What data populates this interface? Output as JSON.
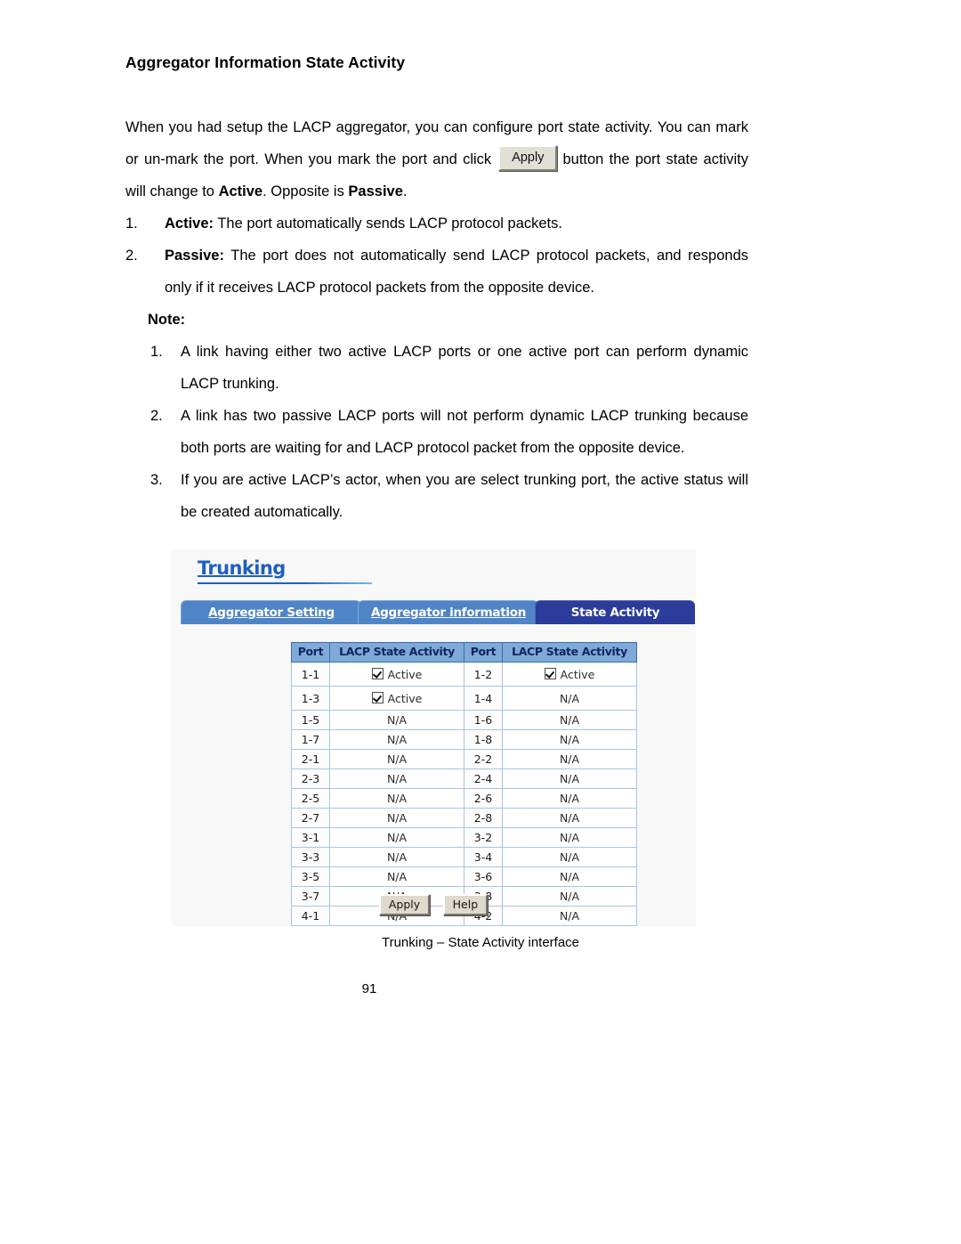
{
  "document": {
    "title": "Aggregator Information State Activity",
    "paragraph1_a": "When you had setup the LACP aggregator, you can configure port state activity. You can mark or un-mark the port. When you mark the port and click",
    "apply_button_label": "Apply",
    "paragraph1_b": "button the port state activity will change to",
    "paragraph1_bold1": "Active",
    "paragraph1_c": ". Opposite is",
    "paragraph1_bold2": "Passive",
    "paragraph1_d": ".",
    "main_list": [
      {
        "number": "1.",
        "term": "Active:",
        "text": "The port automatically sends LACP protocol packets."
      },
      {
        "number": "2.",
        "term": "Passive:",
        "text": "The port does not automatically send LACP protocol packets, and responds only if it receives LACP protocol packets from the opposite device."
      }
    ],
    "note_heading": "Note:",
    "note_list": [
      {
        "number": "1.",
        "text": "A link having either two active LACP ports or one active port can perform dynamic LACP trunking."
      },
      {
        "number": "2.",
        "text": "A link has two passive LACP ports will not perform dynamic LACP trunking because both ports are waiting for and LACP protocol packet from the opposite device."
      },
      {
        "number": "3.",
        "text": "If you are active LACP’s actor, when you are select trunking port, the active status will be created automatically."
      }
    ],
    "figure_caption": "Trunking – State Activity interface",
    "page_number": "91"
  },
  "screenshot": {
    "app_title": "Trunking",
    "tabs": [
      {
        "label": "Aggregator Setting",
        "active": false
      },
      {
        "label": "Aggregator information",
        "active": false
      },
      {
        "label": "State Activity",
        "active": true
      }
    ],
    "table": {
      "headers": [
        "Port",
        "LACP State Activity",
        "Port",
        "LACP State Activity"
      ],
      "active_label": "Active",
      "na_label": "N/A",
      "rows": [
        {
          "port_left": "1-1",
          "state_left": "Active",
          "checked_left": true,
          "port_right": "1-2",
          "state_right": "Active",
          "checked_right": true
        },
        {
          "port_left": "1-3",
          "state_left": "Active",
          "checked_left": true,
          "port_right": "1-4",
          "state_right": "N/A",
          "checked_right": false
        },
        {
          "port_left": "1-5",
          "state_left": "N/A",
          "checked_left": false,
          "port_right": "1-6",
          "state_right": "N/A",
          "checked_right": false
        },
        {
          "port_left": "1-7",
          "state_left": "N/A",
          "checked_left": false,
          "port_right": "1-8",
          "state_right": "N/A",
          "checked_right": false
        },
        {
          "port_left": "2-1",
          "state_left": "N/A",
          "checked_left": false,
          "port_right": "2-2",
          "state_right": "N/A",
          "checked_right": false
        },
        {
          "port_left": "2-3",
          "state_left": "N/A",
          "checked_left": false,
          "port_right": "2-4",
          "state_right": "N/A",
          "checked_right": false
        },
        {
          "port_left": "2-5",
          "state_left": "N/A",
          "checked_left": false,
          "port_right": "2-6",
          "state_right": "N/A",
          "checked_right": false
        },
        {
          "port_left": "2-7",
          "state_left": "N/A",
          "checked_left": false,
          "port_right": "2-8",
          "state_right": "N/A",
          "checked_right": false
        },
        {
          "port_left": "3-1",
          "state_left": "N/A",
          "checked_left": false,
          "port_right": "3-2",
          "state_right": "N/A",
          "checked_right": false
        },
        {
          "port_left": "3-3",
          "state_left": "N/A",
          "checked_left": false,
          "port_right": "3-4",
          "state_right": "N/A",
          "checked_right": false
        },
        {
          "port_left": "3-5",
          "state_left": "N/A",
          "checked_left": false,
          "port_right": "3-6",
          "state_right": "N/A",
          "checked_right": false
        },
        {
          "port_left": "3-7",
          "state_left": "N/A",
          "checked_left": false,
          "port_right": "3-8",
          "state_right": "N/A",
          "checked_right": false
        },
        {
          "port_left": "4-1",
          "state_left": "N/A",
          "checked_left": false,
          "port_right": "4-2",
          "state_right": "N/A",
          "checked_right": false
        }
      ]
    },
    "buttons": [
      {
        "label": "Apply"
      },
      {
        "label": "Help"
      }
    ],
    "colors": {
      "title": "#1f5fbf",
      "tab_inactive": "#4f85c6",
      "tab_active": "#2b3c9b",
      "table_header_bg": "#7fa9d8",
      "table_header_text": "#10265c",
      "table_border": "#3a6ea8",
      "panel_bg": "#f8f8f8",
      "button_face": "#dedacd"
    }
  }
}
